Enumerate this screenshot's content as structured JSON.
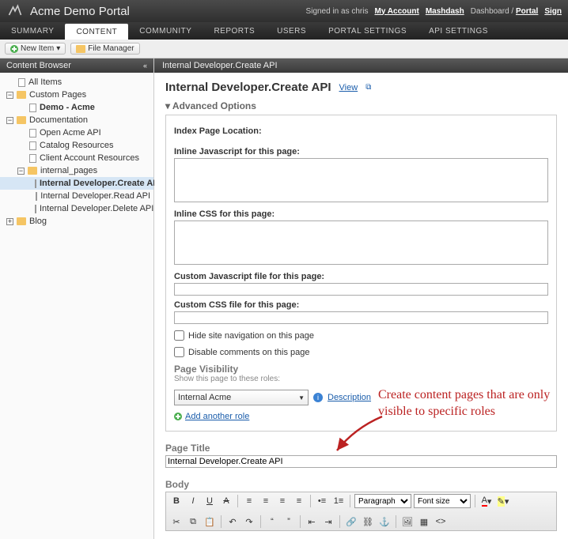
{
  "header": {
    "title": "Acme Demo Portal",
    "signed_in_prefix": "Signed in as",
    "user": "chris",
    "my_account": "My Account",
    "mashdash": "Mashdash",
    "dashboard": "Dashboard",
    "portal": "Portal",
    "sign": "Sign"
  },
  "nav": {
    "items": [
      "SUMMARY",
      "CONTENT",
      "COMMUNITY",
      "REPORTS",
      "USERS",
      "PORTAL SETTINGS",
      "API SETTINGS"
    ],
    "active_index": 1
  },
  "toolbar": {
    "new_item": "New Item",
    "file_manager": "File Manager"
  },
  "sidebar": {
    "title": "Content Browser",
    "all_items": "All Items",
    "nodes": [
      {
        "label": "Custom Pages",
        "children": [
          {
            "label": "Demo - Acme",
            "bold": true
          }
        ]
      },
      {
        "label": "Documentation",
        "children": [
          {
            "label": "Open Acme API"
          },
          {
            "label": "Catalog Resources"
          },
          {
            "label": "Client Account Resources"
          },
          {
            "label": "internal_pages",
            "children": [
              {
                "label": "Internal Developer.Create API",
                "selected": true
              },
              {
                "label": "Internal Developer.Read API"
              },
              {
                "label": "Internal Developer.Delete API"
              }
            ]
          }
        ]
      },
      {
        "label": "Blog"
      }
    ]
  },
  "content": {
    "breadcrumb": "Internal Developer.Create API",
    "title": "Internal Developer.Create API",
    "view": "View",
    "advanced_options": "Advanced Options",
    "index_page_location": "Index Page Location:",
    "inline_js": "Inline Javascript for this page:",
    "inline_css": "Inline CSS for this page:",
    "custom_js_file": "Custom Javascript file for this page:",
    "custom_css_file": "Custom CSS file for this page:",
    "hide_nav": "Hide site navigation on this page",
    "disable_comments": "Disable comments on this page",
    "page_visibility": "Page Visibility",
    "visibility_desc": "Show this page to these roles:",
    "role_selected": "Internal Acme",
    "description_link": "Description",
    "add_role": "Add another role",
    "page_title_label": "Page Title",
    "page_title_value": "Internal Developer.Create API",
    "body_label": "Body",
    "rte": {
      "paragraph": "Paragraph",
      "font_size": "Font size"
    }
  },
  "annotation": {
    "text": "Create content pages that are only visible to specific roles"
  }
}
